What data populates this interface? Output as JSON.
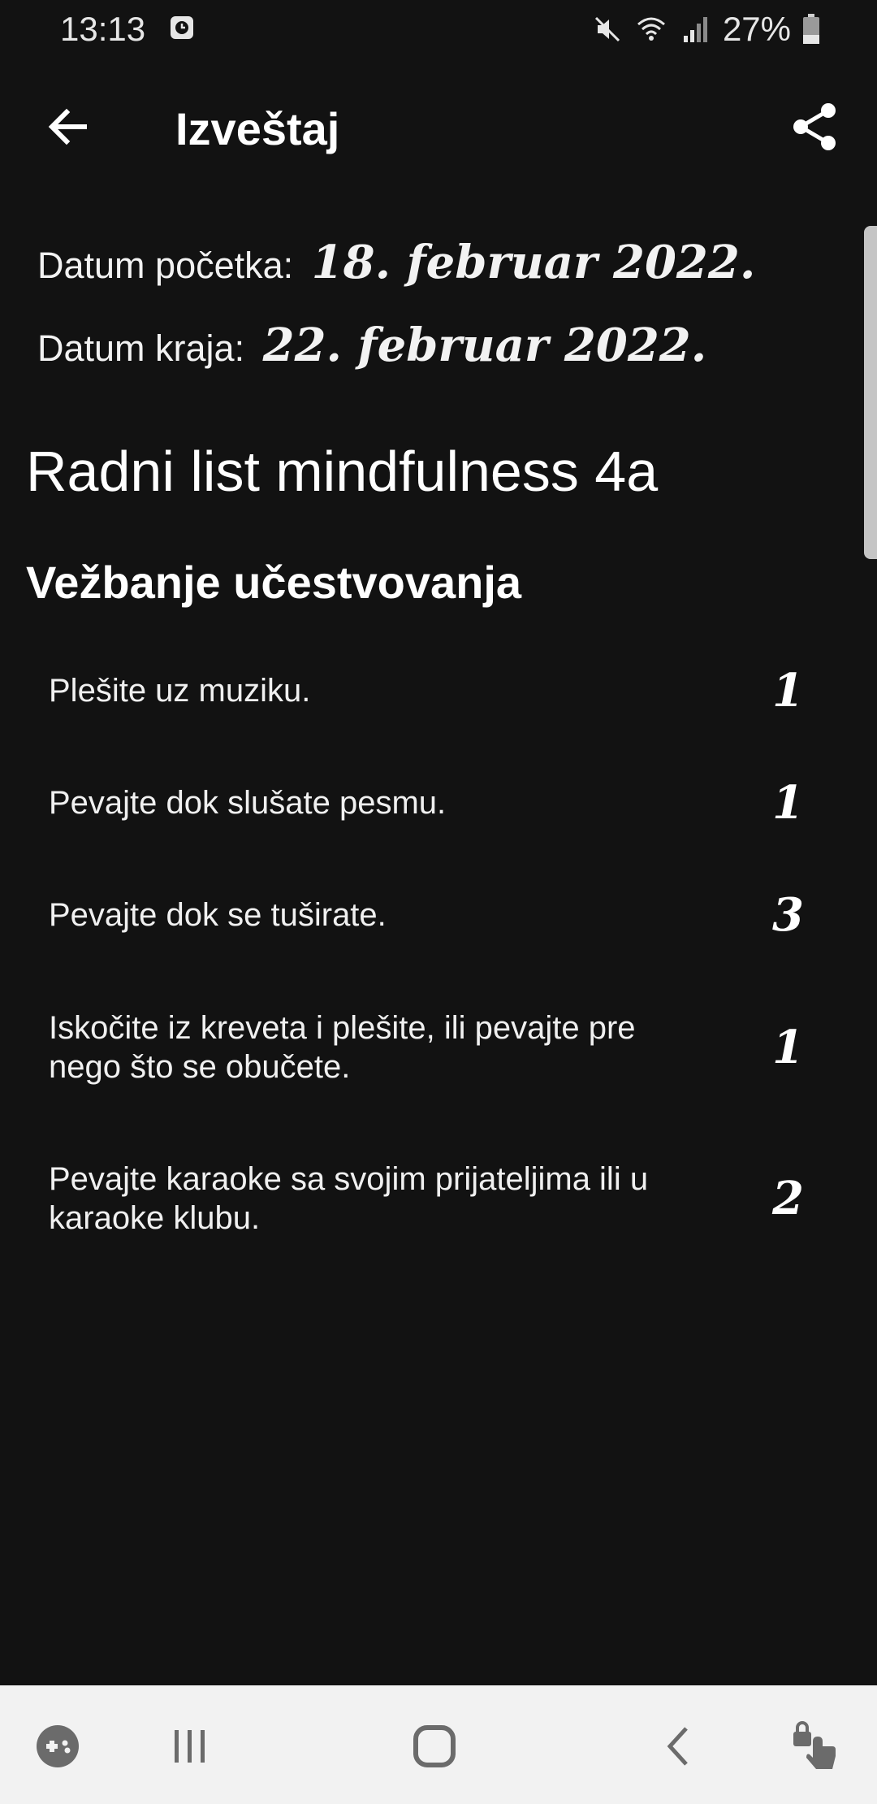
{
  "status_bar": {
    "time": "13:13",
    "battery": "27%",
    "icons": [
      "alarm-icon",
      "mute-icon",
      "wifi-icon",
      "signal-icon",
      "battery-icon"
    ]
  },
  "app_bar": {
    "title": "Izveštaj",
    "back_icon": "arrow-left-icon",
    "share_icon": "share-icon"
  },
  "dates": {
    "start_label": "Datum početka:",
    "start_value": "18. februar 2022.",
    "end_label": "Datum kraja:",
    "end_value": "22. februar 2022."
  },
  "worksheet_title": "Radni list mindfulness 4a",
  "section_title": "Vežbanje učestvovanja",
  "items": [
    {
      "text": "Plešite uz muziku.",
      "score": "1"
    },
    {
      "text": "Pevajte dok slušate pesmu.",
      "score": "1"
    },
    {
      "text": "Pevajte dok se tuširate.",
      "score": "3"
    },
    {
      "text": "Iskočite iz kreveta i plešite, ili pevajte pre nego što se obučete.",
      "score": "1"
    },
    {
      "text": "Pevajte karaoke sa svojim prijateljima ili u karaoke klubu.",
      "score": "2"
    }
  ],
  "nav_bar": {
    "icons": [
      "game-launcher-icon",
      "recents-icon",
      "home-icon",
      "back-icon",
      "touch-lock-icon"
    ]
  },
  "colors": {
    "background": "#121212",
    "text": "#ffffff",
    "nav_background": "#f2f2f2",
    "nav_icon": "#6b6b6b"
  }
}
